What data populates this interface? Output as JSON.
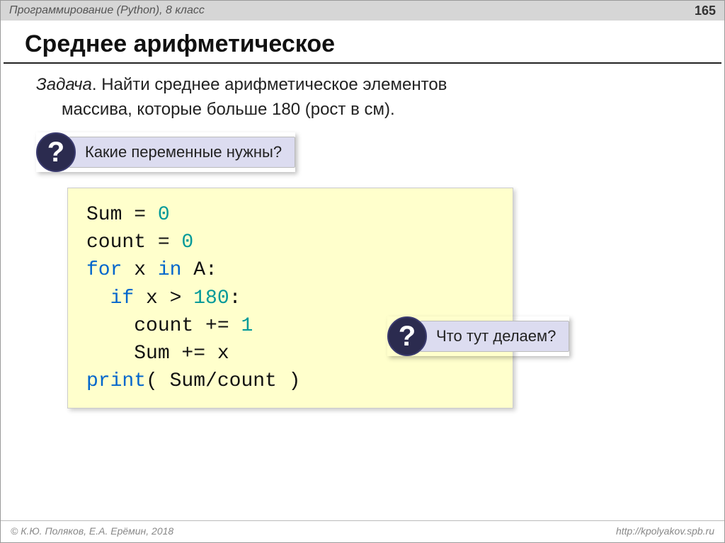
{
  "header": {
    "course": "Программирование (Python), 8 класс",
    "page": "165"
  },
  "title": "Среднее арифметическое",
  "problem": {
    "label": "Задача",
    "text1": ". Найти среднее арифметическое элементов",
    "text2": "массива, которые больше 180 (рост в см)."
  },
  "callout1": {
    "mark": "?",
    "text": "Какие переменные нужны?"
  },
  "callout2": {
    "mark": "?",
    "text": "Что тут делаем?"
  },
  "code": {
    "l1a": "Sum = ",
    "l1n": "0",
    "l2a": "count = ",
    "l2n": "0",
    "l3a": "for",
    "l3b": " x ",
    "l3c": "in",
    "l3d": " A:",
    "l4a": "  ",
    "l4b": "if",
    "l4c": " x > ",
    "l4n": "180",
    "l4d": ":",
    "l5": "    count += ",
    "l5n": "1",
    "l6": "    Sum += x",
    "l7a": "print",
    "l7b": "( Sum/count )"
  },
  "footer": {
    "copyright": "© К.Ю. Поляков, Е.А. Ерёмин, 2018",
    "url": "http://kpolyakov.spb.ru"
  }
}
